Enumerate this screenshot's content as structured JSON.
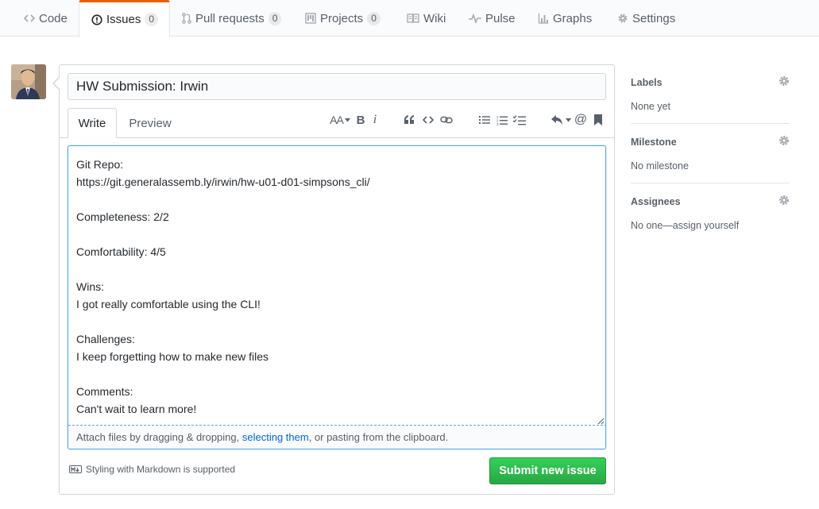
{
  "nav": {
    "tabs": [
      {
        "label": "Code",
        "icon": "code-icon"
      },
      {
        "label": "Issues",
        "icon": "issue-opened-icon",
        "count": "0"
      },
      {
        "label": "Pull requests",
        "icon": "git-pull-request-icon",
        "count": "0"
      },
      {
        "label": "Projects",
        "icon": "project-icon",
        "count": "0"
      },
      {
        "label": "Wiki",
        "icon": "book-icon"
      },
      {
        "label": "Pulse",
        "icon": "pulse-icon"
      },
      {
        "label": "Graphs",
        "icon": "graph-icon"
      },
      {
        "label": "Settings",
        "icon": "gear-icon"
      }
    ],
    "selected": "Issues",
    "accent": "#e36209"
  },
  "issue": {
    "title": "HW Submission: Irwin",
    "tabs": {
      "write": "Write",
      "preview": "Preview"
    },
    "body": "Git Repo:\nhttps://git.generalassemb.ly/irwin/hw-u01-d01-simpsons_cli/\n\nCompleteness: 2/2\n\nComfortability: 4/5\n\nWins:\nI got really comfortable using the CLI!\n\nChallenges:\nI keep forgetting how to make new files\n\nComments:\nCan't wait to learn more!",
    "attach": {
      "before": "Attach files by dragging & dropping, ",
      "link": "selecting them",
      "after": ", or pasting from the clipboard."
    },
    "markdown_note": "Styling with Markdown is supported",
    "submit_label": "Submit new issue",
    "toolbar": {
      "text_size": "AA",
      "bold": "B",
      "italic": "i",
      "mention": "@"
    }
  },
  "sidebar": {
    "labels": {
      "heading": "Labels",
      "value": "None yet"
    },
    "milestone": {
      "heading": "Milestone",
      "value": "No milestone"
    },
    "assignees": {
      "heading": "Assignees",
      "value": "No one—assign yourself"
    }
  },
  "colors": {
    "submit_green": "#28a745",
    "focus_blue": "#51a7e8",
    "link": "#0366d6"
  }
}
